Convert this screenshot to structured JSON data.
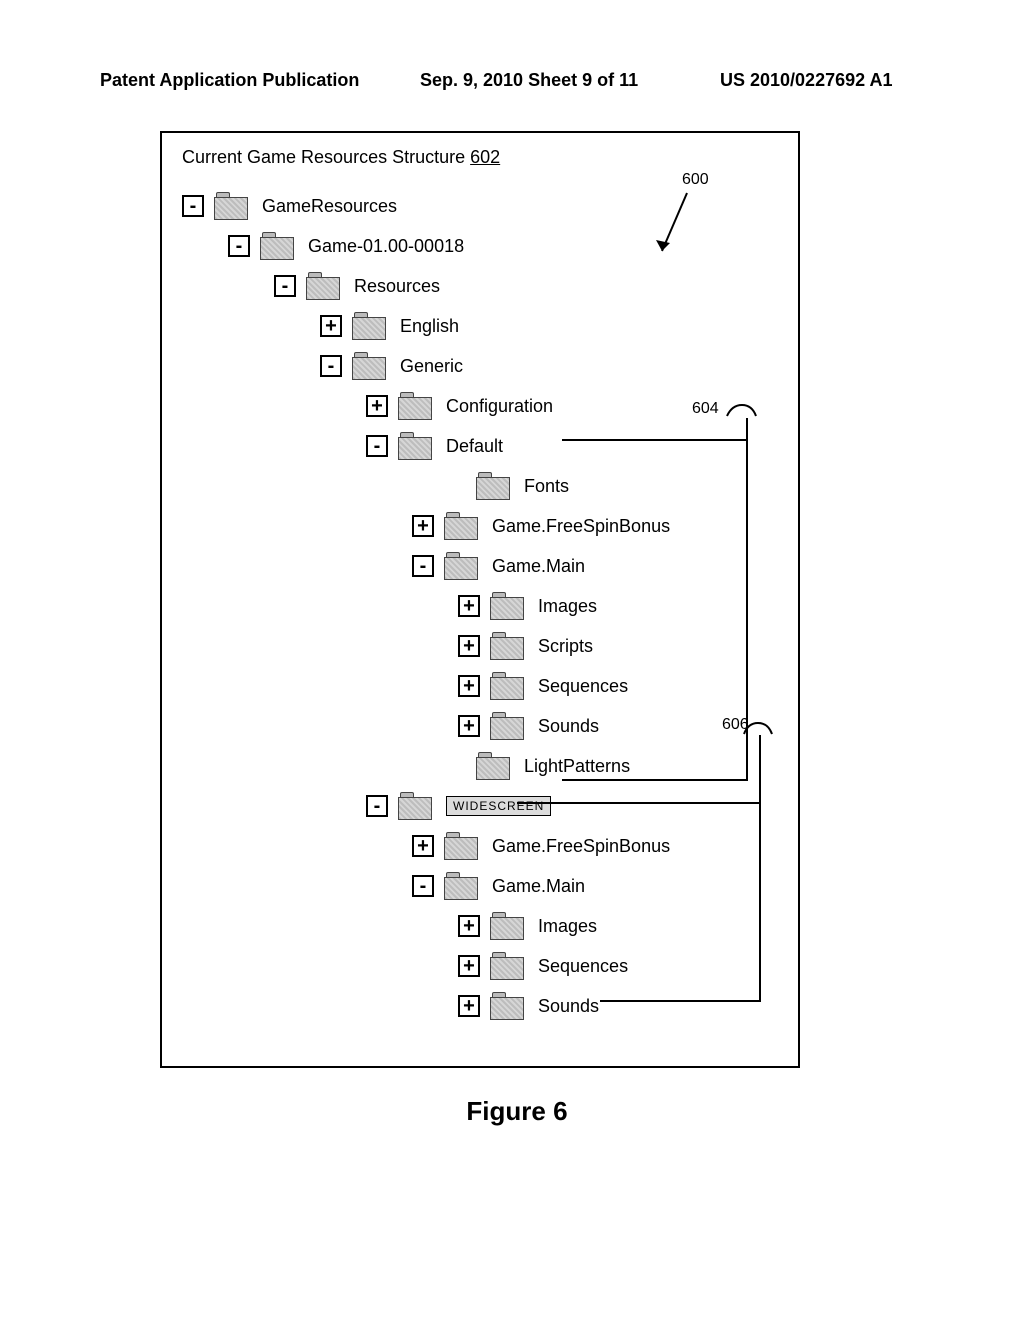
{
  "header": {
    "left": "Patent Application Publication",
    "mid": "Sep. 9, 2010   Sheet 9 of 11",
    "right": "US 2010/0227692 A1"
  },
  "box_title_prefix": "Current Game Resources Structure",
  "box_title_num": "602",
  "callouts": {
    "c600": "600",
    "c604": "604",
    "c606": "606"
  },
  "rows": [
    {
      "indent": 0,
      "toggle": "-",
      "label": "GameResources"
    },
    {
      "indent": 46,
      "toggle": "-",
      "label": "Game-01.00-00018"
    },
    {
      "indent": 92,
      "toggle": "-",
      "label": "Resources"
    },
    {
      "indent": 138,
      "toggle": "+",
      "label": "English"
    },
    {
      "indent": 138,
      "toggle": "-",
      "label": "Generic"
    },
    {
      "indent": 184,
      "toggle": "+",
      "label": "Configuration"
    },
    {
      "indent": 184,
      "toggle": "-",
      "label": "Default"
    },
    {
      "indent": 262,
      "toggle": "",
      "label": "Fonts"
    },
    {
      "indent": 230,
      "toggle": "+",
      "label": "Game.FreeSpinBonus"
    },
    {
      "indent": 230,
      "toggle": "-",
      "label": "Game.Main"
    },
    {
      "indent": 276,
      "toggle": "+",
      "label": "Images"
    },
    {
      "indent": 276,
      "toggle": "+",
      "label": "Scripts"
    },
    {
      "indent": 276,
      "toggle": "+",
      "label": "Sequences"
    },
    {
      "indent": 276,
      "toggle": "+",
      "label": "Sounds"
    },
    {
      "indent": 262,
      "toggle": "",
      "label": "LightPatterns"
    },
    {
      "indent": 184,
      "toggle": "-",
      "label": "WIDESCREEN",
      "boxed": true
    },
    {
      "indent": 230,
      "toggle": "+",
      "label": "Game.FreeSpinBonus"
    },
    {
      "indent": 230,
      "toggle": "-",
      "label": "Game.Main"
    },
    {
      "indent": 276,
      "toggle": "+",
      "label": "Images"
    },
    {
      "indent": 276,
      "toggle": "+",
      "label": "Sequences"
    },
    {
      "indent": 276,
      "toggle": "+",
      "label": "Sounds"
    }
  ],
  "figure_caption": "Figure 6"
}
